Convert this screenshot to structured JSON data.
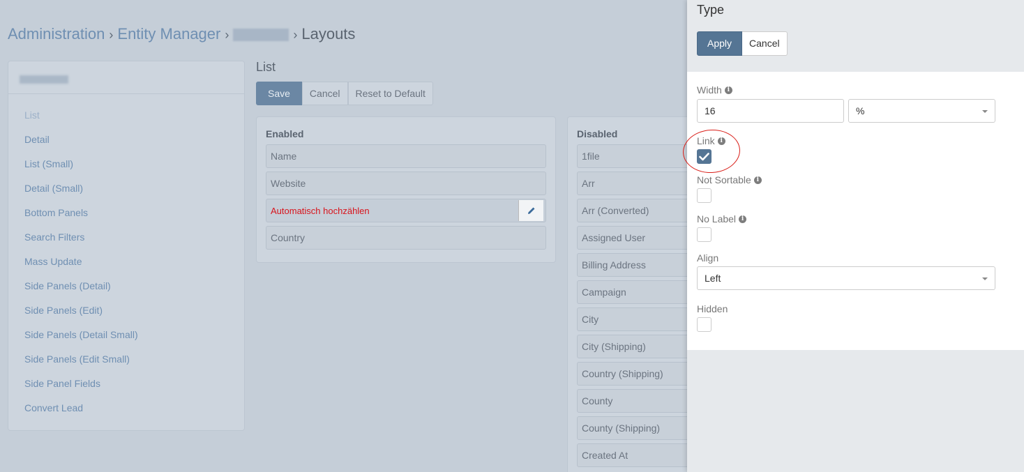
{
  "breadcrumb": {
    "items": [
      "Administration",
      "Entity Manager"
    ],
    "current": "Layouts",
    "separator": "›"
  },
  "sidebar": {
    "items": [
      {
        "label": "List",
        "active": true
      },
      {
        "label": "Detail"
      },
      {
        "label": "List (Small)"
      },
      {
        "label": "Detail (Small)"
      },
      {
        "label": "Bottom Panels"
      },
      {
        "label": "Search Filters"
      },
      {
        "label": "Mass Update"
      },
      {
        "label": "Side Panels (Detail)"
      },
      {
        "label": "Side Panels (Edit)"
      },
      {
        "label": "Side Panels (Detail Small)"
      },
      {
        "label": "Side Panels (Edit Small)"
      },
      {
        "label": "Side Panel Fields"
      },
      {
        "label": "Convert Lead"
      }
    ]
  },
  "layout": {
    "title": "List",
    "save_label": "Save",
    "cancel_label": "Cancel",
    "reset_label": "Reset to Default",
    "enabled_title": "Enabled",
    "enabled_items": [
      "Name",
      "Website",
      "Automatisch hochzählen",
      "Country"
    ],
    "disabled_title": "Disabled",
    "disabled_items": [
      "1file",
      "Arr",
      "Arr (Converted)",
      "Assigned User",
      "Billing Address",
      "Campaign",
      "City",
      "City (Shipping)",
      "Country (Shipping)",
      "County",
      "County (Shipping)",
      "Created At"
    ]
  },
  "modal": {
    "title": "Type",
    "apply_label": "Apply",
    "cancel_label": "Cancel",
    "width_label": "Width",
    "width_value": "16",
    "width_unit": "%",
    "link_label": "Link",
    "link_checked": true,
    "not_sortable_label": "Not Sortable",
    "no_label_label": "No Label",
    "align_label": "Align",
    "align_value": "Left",
    "hidden_label": "Hidden",
    "info_glyph": "i"
  },
  "colors": {
    "primary": "#557594",
    "annotation_red": "#d91e18",
    "link_blue": "#6f8fb2"
  }
}
